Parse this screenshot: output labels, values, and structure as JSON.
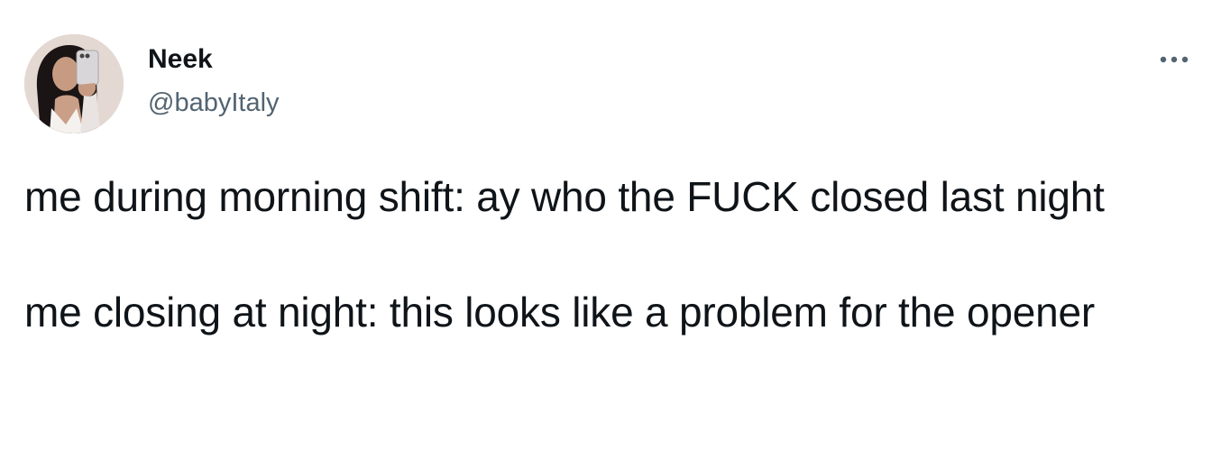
{
  "author": {
    "display_name": "Neek",
    "handle": "@babyItaly",
    "avatar_icon": "profile-photo"
  },
  "menu": {
    "icon": "more-horizontal-icon"
  },
  "tweet": {
    "paragraph_1": "me during morning shift: ay who the FUCK closed last night",
    "paragraph_2": "me closing at night: this looks like a problem for the opener"
  },
  "colors": {
    "text": "#0f1419",
    "secondary_text": "#536471",
    "background": "#ffffff"
  }
}
